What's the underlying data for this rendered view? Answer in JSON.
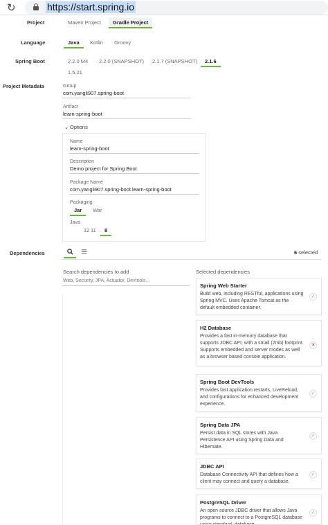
{
  "browser": {
    "url": "https://start.spring.io"
  },
  "project": {
    "label": "Project",
    "options": [
      "Maven Project",
      "Gradle Project"
    ],
    "selected": "Gradle Project"
  },
  "language": {
    "label": "Language",
    "options": [
      "Java",
      "Kotlin",
      "Groovy"
    ],
    "selected": "Java"
  },
  "spring_boot": {
    "label": "Spring Boot",
    "options": [
      "2.2.0 M4",
      "2.2.0 (SNAPSHOT)",
      "2.1.7 (SNAPSHOT)",
      "2.1.6",
      "1.5.21"
    ],
    "selected": "2.1.6"
  },
  "metadata": {
    "label": "Project Metadata",
    "group_label": "Group",
    "group_value": "com.yangli907.spring-boot",
    "artifact_label": "Artifact",
    "artifact_value": "learn-spring-boot",
    "options_toggle": "Options",
    "name_label": "Name",
    "name_value": "learn-spring-boot",
    "description_label": "Description",
    "description_value": "Demo project for Spring Boot",
    "package_label": "Package Name",
    "package_value": "com.yangli907.spring-boot.learn-spring-boot",
    "packaging_label": "Packaging",
    "packaging_options": [
      "Jar",
      "War"
    ],
    "packaging_selected": "Jar",
    "java_label": "Java",
    "java_options": [
      "12",
      "11",
      "8"
    ],
    "java_selected": "8"
  },
  "dependencies": {
    "label": "Dependencies",
    "selected_count": "6",
    "selected_suffix": "selected",
    "search_label": "Search dependencies to add",
    "search_placeholder": "Web, Security, JPA, Actuator, Devtools...",
    "selected_heading": "Selected dependencies",
    "tabs": [
      "search-icon",
      "list-icon"
    ],
    "cards": [
      {
        "name": "Spring Web Starter",
        "desc": "Build web, including RESTful, applications using Spring MVC. Uses Apache Tomcat as the default embedded container.",
        "status": "ok"
      },
      {
        "name": "H2 Database",
        "desc": "Provides a fast in-memory database that supports JDBC API, with a small (2mb) footprint. Supports embedded and server modes as well as a browser based console application.",
        "status": "remove"
      },
      {
        "name": "Spring Boot DevTools",
        "desc": "Provides fast application restarts, LiveReload, and configurations for enhanced development experience.",
        "status": "ok"
      },
      {
        "name": "Spring Data JPA",
        "desc": "Persist data in SQL stores with Java Persistence API using Spring Data and Hibernate.",
        "status": "ok"
      },
      {
        "name": "JDBC API",
        "desc": "Database Connectivity API that defines how a client may connect and query a database.",
        "status": "ok"
      },
      {
        "name": "PostgreSQL Driver",
        "desc": "An open source JDBC driver that allows Java programs to connect to a PostgreSQL database using standard, database",
        "status": "ok"
      }
    ],
    "icons": {
      "ok": "✓",
      "remove": "✕"
    }
  },
  "colors": {
    "accent": "#6db33f"
  }
}
